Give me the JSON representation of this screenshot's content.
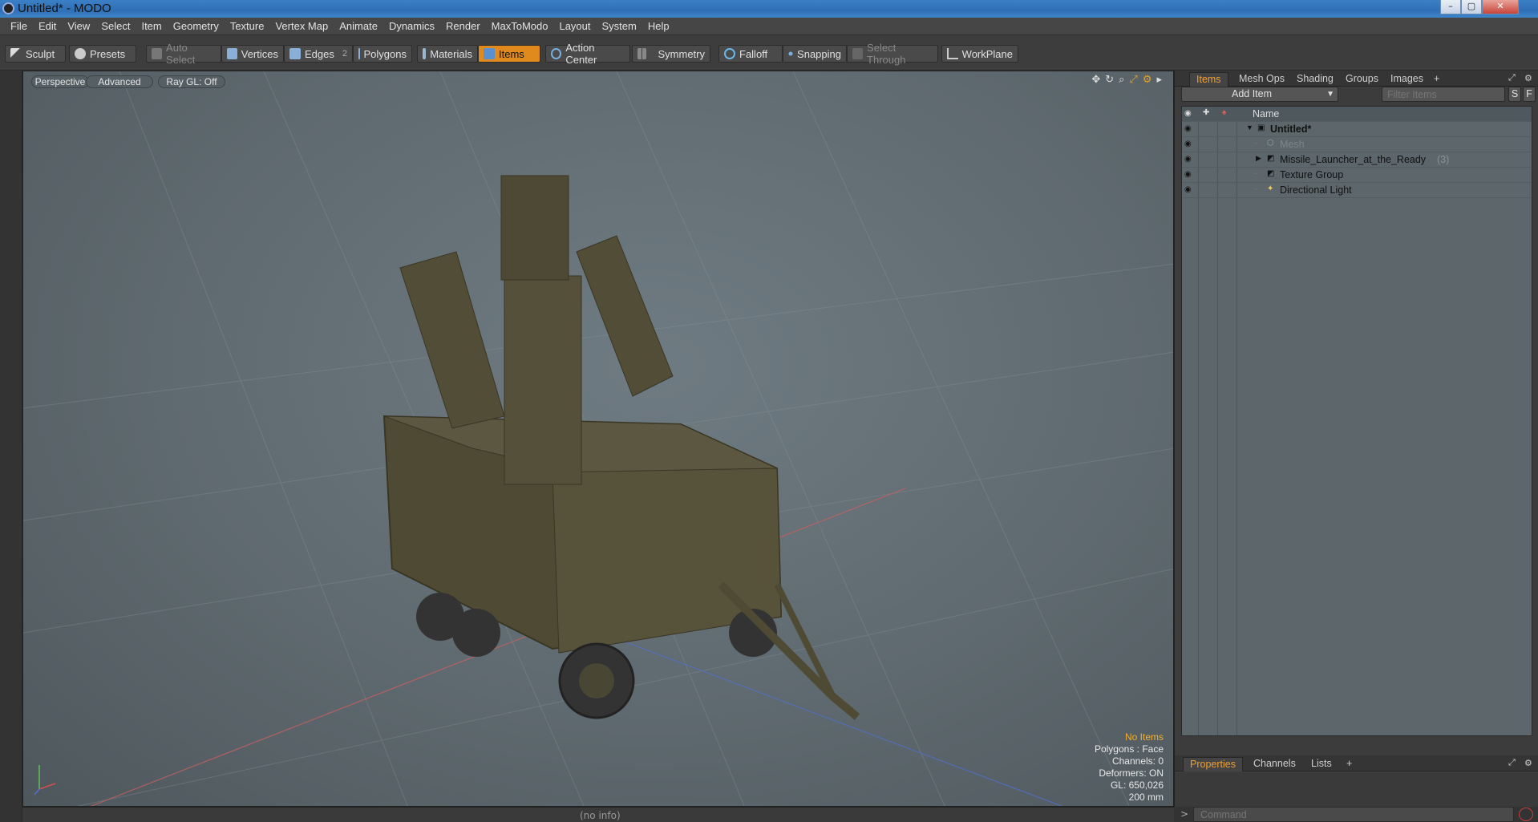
{
  "window": {
    "title": "Untitled* - MODO",
    "controls": {
      "minimize": "–",
      "maximize": "▢",
      "close": "✕"
    }
  },
  "menu": [
    "File",
    "Edit",
    "View",
    "Select",
    "Item",
    "Geometry",
    "Texture",
    "Vertex Map",
    "Animate",
    "Dynamics",
    "Render",
    "MaxToModo",
    "Layout",
    "System",
    "Help"
  ],
  "toolbar": {
    "sculpt": "Sculpt",
    "presets": "Presets",
    "auto_select": "Auto Select",
    "vertices": "Vertices",
    "edges": "Edges",
    "edges_count": "2",
    "polygons": "Polygons",
    "materials": "Materials",
    "items": "Items",
    "action_center": "Action Center",
    "symmetry": "Symmetry",
    "falloff": "Falloff",
    "snapping": "Snapping",
    "select_through": "Select Through",
    "workplane": "WorkPlane"
  },
  "viewport": {
    "view_mode": "Perspective",
    "shading": "Advanced",
    "raygl": "Ray GL: Off",
    "info": {
      "selection": "No Items",
      "polygons": "Polygons : Face",
      "channels": "Channels: 0",
      "deformers": "Deformers: ON",
      "gl": "GL: 650,026",
      "scale": "200 mm"
    },
    "status": "(no info)"
  },
  "items_panel": {
    "tabs": [
      "Items",
      "Mesh Ops",
      "Shading",
      "Groups",
      "Images"
    ],
    "tab_add": "+",
    "add_item": "Add Item",
    "filter_placeholder": "Filter Items",
    "filter_s": "S",
    "filter_f": "F",
    "column_name": "Name",
    "rows": [
      {
        "label": "Untitled*",
        "indent": 0,
        "bold": true
      },
      {
        "label": "Mesh",
        "indent": 1,
        "dim": true
      },
      {
        "label": "Missile_Launcher_at_the_Ready",
        "count": "(3)",
        "indent": 1
      },
      {
        "label": "Texture Group",
        "indent": 1
      },
      {
        "label": "Directional Light",
        "indent": 1
      }
    ]
  },
  "properties_panel": {
    "tabs": [
      "Properties",
      "Channels",
      "Lists"
    ],
    "tab_add": "+",
    "command_placeholder": "Command"
  },
  "colors": {
    "accent": "#e08a1e",
    "viewport_bg": "#5f6a70",
    "list_bg": "#5c666b"
  }
}
